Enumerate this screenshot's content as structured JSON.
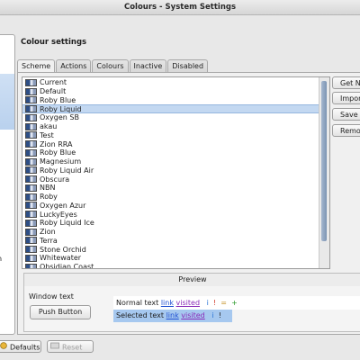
{
  "window": {
    "title": "Colours - System Settings"
  },
  "sidebar": {
    "fragment": "n"
  },
  "section": {
    "title": "Colour settings"
  },
  "tabs": [
    {
      "label": "Scheme",
      "active": true
    },
    {
      "label": "Actions",
      "active": false
    },
    {
      "label": "Colours",
      "active": false
    },
    {
      "label": "Inactive",
      "active": false
    },
    {
      "label": "Disabled",
      "active": false
    }
  ],
  "schemes": [
    "Current",
    "Default",
    "Roby Blue",
    "Roby Liquid",
    "Oxygen SB",
    "akau",
    "Test",
    "Zion RRA",
    "Roby Blue",
    "Magnesium",
    "Roby Liquid Air",
    "Obscura",
    "NBN",
    "Roby",
    "Oxygen Azur",
    "LuckyEyes",
    "Roby Liquid Ice",
    "Zion",
    "Terra",
    "Stone Orchid",
    "Whitewater",
    "Obsidian Coast"
  ],
  "selected_scheme_index": 3,
  "side_buttons": {
    "get_new": "Get New",
    "import": "Import",
    "save": "Save",
    "remove": "Remove"
  },
  "preview": {
    "title": "Preview",
    "window_text": "Window text",
    "push_button": "Push Button",
    "normal_text": "Normal text",
    "selected_text": "Selected text",
    "link": "link",
    "visited": "visited",
    "marks": {
      "info": "i",
      "alert": "!",
      "neutral": "=",
      "positive": "+"
    }
  },
  "bottom": {
    "defaults": "Defaults",
    "reset": "Reset"
  },
  "colors": {
    "selection": "#c3d8f1",
    "link": "#1f4fd2",
    "visited": "#8a2bb8"
  }
}
